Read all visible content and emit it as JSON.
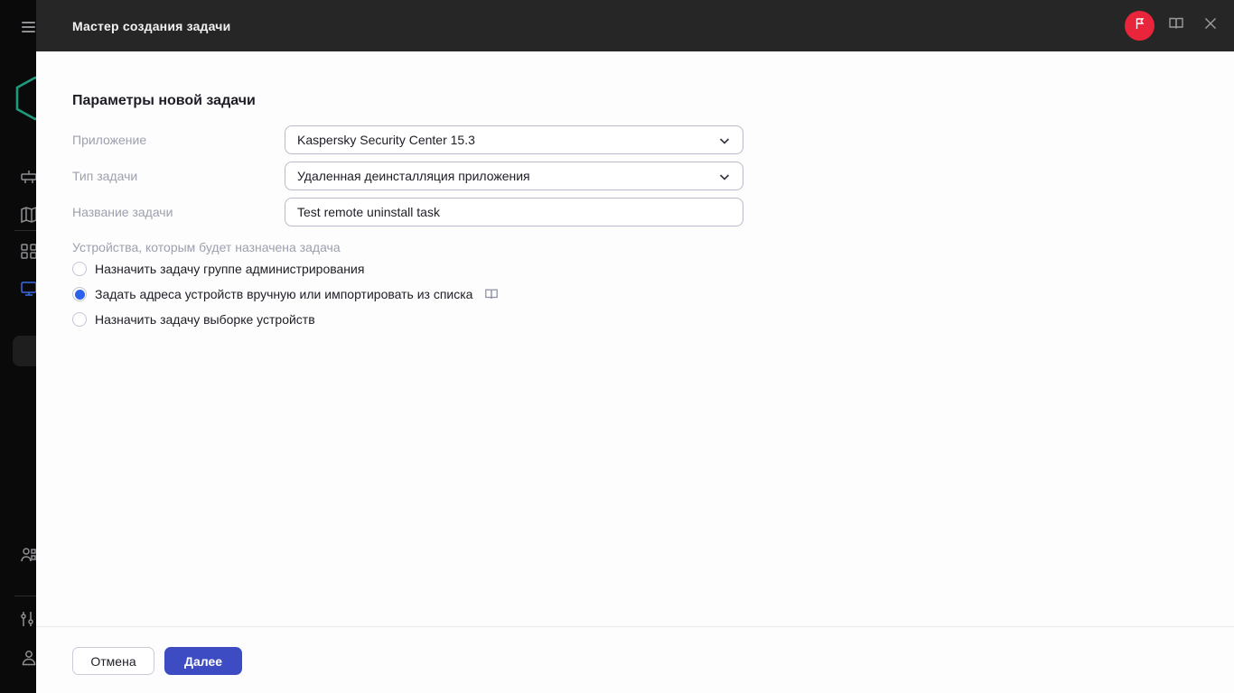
{
  "header": {
    "title": "Мастер создания задачи",
    "whats_new_icon": "flag-icon",
    "help_icon": "open-book-icon",
    "close_icon": "close-icon"
  },
  "sidebar": {
    "items": [
      "menu-icon",
      "kaspersky-logo",
      "server-icon",
      "map-icon",
      "grid-icon",
      "monitor-icon",
      "users-icon",
      "sliders-icon",
      "user-icon"
    ]
  },
  "form": {
    "heading": "Параметры новой задачи",
    "fields": [
      {
        "label": "Приложение",
        "value": "Kaspersky Security Center 15.3",
        "type": "select"
      },
      {
        "label": "Тип задачи",
        "value": "Удаленная деинсталляция приложения",
        "type": "select"
      },
      {
        "label": "Название задачи",
        "value": "Test remote uninstall task",
        "type": "text"
      }
    ],
    "devices_section": {
      "label": "Устройства, которым будет назначена задача",
      "options": [
        {
          "label": "Назначить задачу группе администрирования",
          "selected": false
        },
        {
          "label": "Задать адреса устройств вручную или импортировать из списка",
          "selected": true,
          "has_help_icon": true
        },
        {
          "label": "Назначить задачу выборке устройств",
          "selected": false
        }
      ]
    }
  },
  "footer": {
    "cancel_label": "Отмена",
    "next_label": "Далее"
  },
  "colors": {
    "accent_blue": "#2a63ea",
    "primary_button": "#3e4cc4",
    "brand_red": "#e8253a",
    "header_bg": "#262626",
    "sidebar_bg": "#0a0a0a",
    "logo_teal": "#1f9a7d"
  }
}
